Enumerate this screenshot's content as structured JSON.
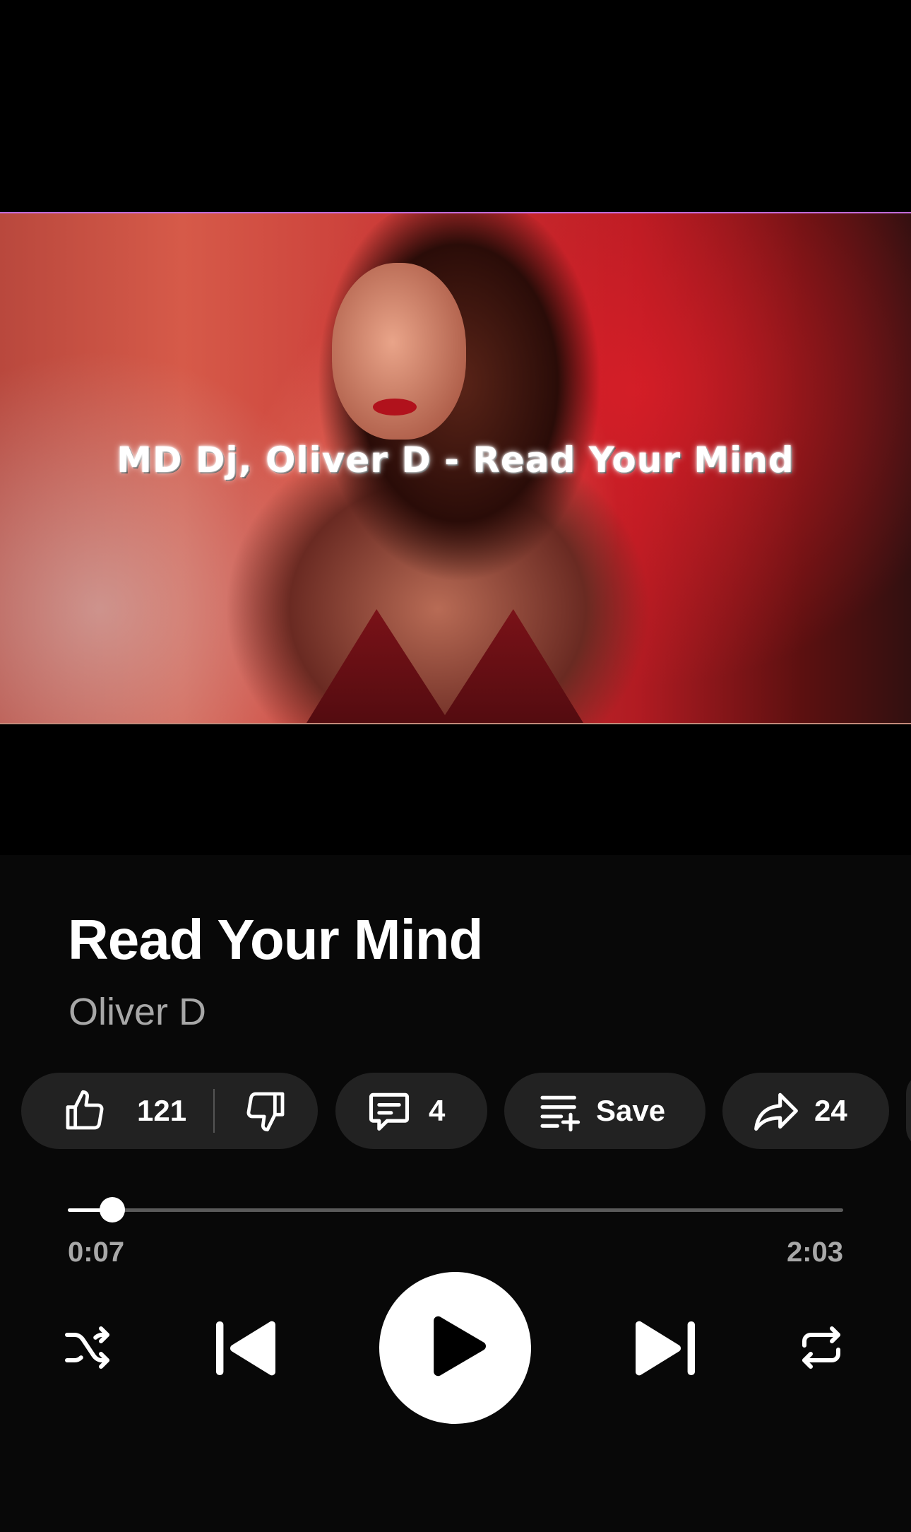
{
  "artwork": {
    "caption": "MD Dj, Oliver D - Read Your Mind"
  },
  "track": {
    "title": "Read Your Mind",
    "artist": "Oliver D"
  },
  "actions": {
    "like_count": "121",
    "comment_count": "4",
    "save_label": "Save",
    "share_count": "24"
  },
  "playback": {
    "elapsed": "0:07",
    "duration": "2:03",
    "progress_fraction": 0.057
  },
  "icons": {
    "like": "thumbs-up-icon",
    "dislike": "thumbs-down-icon",
    "comment": "comment-icon",
    "save": "playlist-add-icon",
    "share": "share-icon",
    "shuffle": "shuffle-icon",
    "previous": "skip-previous-icon",
    "play": "play-icon",
    "next": "skip-next-icon",
    "repeat": "repeat-icon"
  },
  "colors": {
    "background": "#080808",
    "pill": "#222222",
    "secondary_text": "#a7a7a7"
  }
}
